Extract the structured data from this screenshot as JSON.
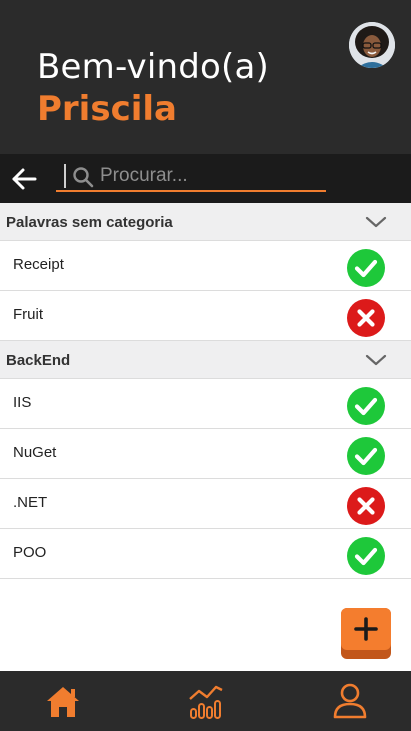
{
  "header": {
    "greeting": "Bem-vindo(a)",
    "user_name": "Priscila",
    "avatar_icon": "user-avatar-photo"
  },
  "search": {
    "back_icon": "arrow-left-icon",
    "search_icon": "search-icon",
    "placeholder": "Procurar..."
  },
  "categories": [
    {
      "name": "Palavras sem categoria",
      "items": [
        {
          "label": "Receipt",
          "status": "correct"
        },
        {
          "label": "Fruit",
          "status": "wrong"
        }
      ]
    },
    {
      "name": "BackEnd",
      "items": [
        {
          "label": "IIS",
          "status": "correct"
        },
        {
          "label": "NuGet",
          "status": "correct"
        },
        {
          "label": ".NET",
          "status": "wrong"
        },
        {
          "label": "POO",
          "status": "correct"
        }
      ]
    }
  ],
  "fab": {
    "icon": "plus-icon"
  },
  "nav": {
    "items": [
      {
        "icon": "home-icon"
      },
      {
        "icon": "stats-chart-icon"
      },
      {
        "icon": "profile-icon"
      }
    ]
  },
  "colors": {
    "accent": "#f07d2f",
    "header_bg": "#2b2b2b",
    "correct": "#1ec83a",
    "wrong": "#dc1a1a"
  }
}
